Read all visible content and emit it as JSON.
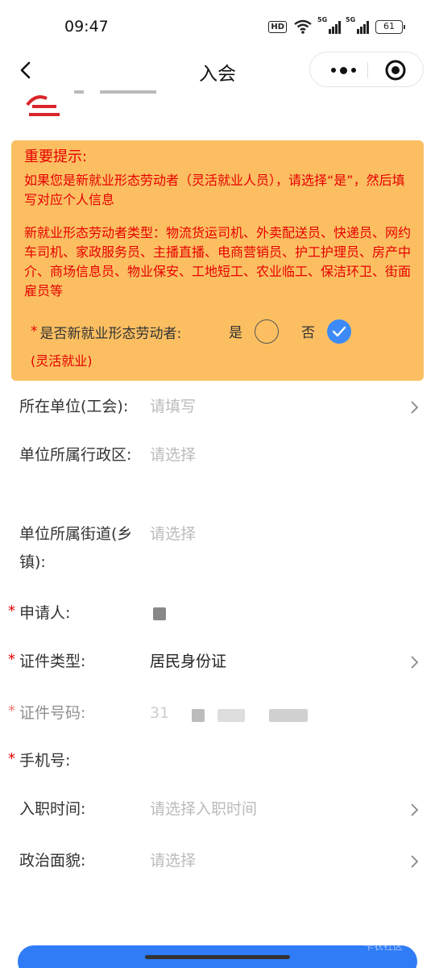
{
  "status_bar": {
    "time": "09:47",
    "hd_badge": "HD",
    "signal1_tag": "5G",
    "signal2_tag": "5G",
    "battery": "61",
    "icons": [
      "hd-icon",
      "wifi-icon",
      "signal-5g-icon",
      "signal-5g-icon",
      "battery-icon"
    ]
  },
  "nav": {
    "title": "入会",
    "back_icon": "chevron-left-icon",
    "more_icon": "more-dots-icon",
    "close_icon": "target-close-icon"
  },
  "notice": {
    "title": "重要提示:",
    "para1": "如果您是新就业形态劳动者（灵活就业人员），请选择“是”，然后填写对应个人信息",
    "para2": "新就业形态劳动者类型：物流货运司机、外卖配送员、快递员、网约车司机、家政服务员、主播直播、电商营销员、护工护理员、房产中介、商场信息员、物业保安、工地短工、农业临工、保洁环卫、街面雇员等",
    "question_star": "*",
    "question_label": "是否新就业形态劳动者:",
    "question_sub": "(灵活就业)",
    "option_yes": "是",
    "option_no": "否",
    "selected": "否",
    "accent_color": "#fbbf62",
    "warning_color": "#e60000",
    "check_color": "#3d8af7"
  },
  "form": {
    "unit": {
      "label": "所在单位(工会):",
      "placeholder": "请填写"
    },
    "district": {
      "label": "单位所属行政区:",
      "placeholder": "请选择"
    },
    "street": {
      "label": "单位所属街道(乡镇):",
      "placeholder": "请选择"
    },
    "applicant": {
      "star": "*",
      "label": "申请人:"
    },
    "id_type": {
      "star": "*",
      "label": "证件类型:",
      "value": "居民身份证"
    },
    "id_number": {
      "star": "*",
      "label": "证件号码:",
      "value_prefix": "31"
    },
    "phone": {
      "star": "*",
      "label": "手机号:"
    },
    "join_time": {
      "label": "入职时间:",
      "placeholder": "请选择入职时间"
    },
    "political": {
      "label": "政治面貌:",
      "placeholder": "请选择"
    }
  },
  "bottom": {
    "watermark": "卡农社区"
  }
}
